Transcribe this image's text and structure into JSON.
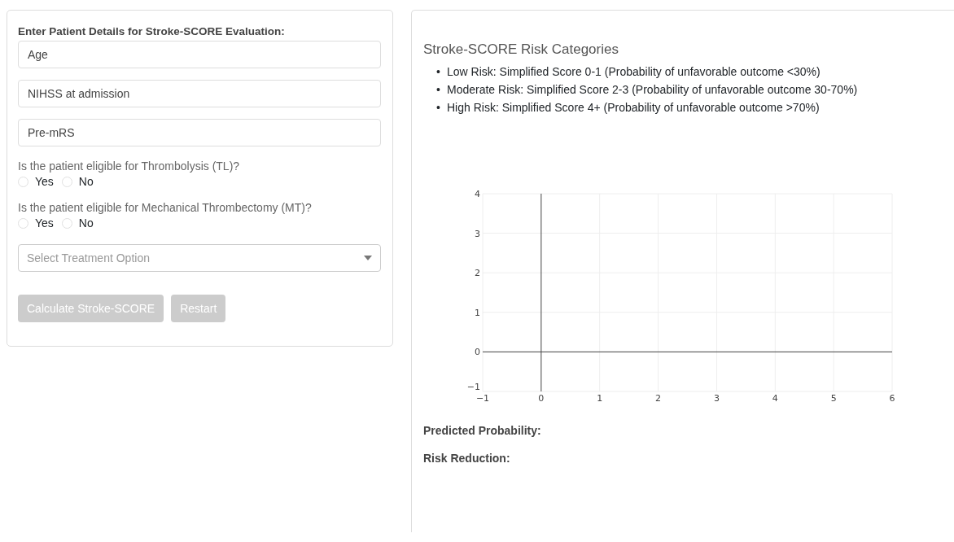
{
  "form": {
    "heading": "Enter Patient Details for Stroke-SCORE Evaluation:",
    "fields": [
      {
        "placeholder": "Age"
      },
      {
        "placeholder": "NIHSS at admission"
      },
      {
        "placeholder": "Pre-mRS"
      }
    ],
    "questions": [
      {
        "label": "Is the patient eligible for Thrombolysis (TL)?",
        "options": [
          {
            "label": "Yes",
            "selected": false
          },
          {
            "label": "No",
            "selected": false
          }
        ]
      },
      {
        "label": "Is the patient eligible for Mechanical Thrombectomy (MT)?",
        "options": [
          {
            "label": "Yes",
            "selected": false
          },
          {
            "label": "No",
            "selected": false
          }
        ]
      }
    ],
    "select": {
      "placeholder": "Select Treatment Option"
    },
    "buttons": [
      {
        "label": "Calculate Stroke-SCORE",
        "disabled": true
      },
      {
        "label": "Restart",
        "disabled": true
      }
    ]
  },
  "results": {
    "title": "Stroke-SCORE Risk Categories",
    "categories": [
      {
        "marker": "•",
        "text": "Low Risk: Simplified Score 0-1 (Probability of unfavorable outcome <30%)"
      },
      {
        "marker": "•",
        "text": "Moderate Risk: Simplified Score 2-3 (Probability of unfavorable outcome 30-70%)"
      },
      {
        "marker": "•",
        "text": "High Risk: Simplified Score 4+ (Probability of unfavorable outcome >70%)"
      }
    ],
    "chart_data": {
      "type": "scatter",
      "grid": true,
      "xlim": [
        -1,
        6
      ],
      "ylim": [
        -1,
        4
      ],
      "xticks": [
        {
          "value": -1,
          "label": "−1"
        },
        0,
        1,
        2,
        3,
        4,
        5,
        6
      ],
      "yticks": [
        {
          "value": -1,
          "label": "−1"
        },
        0,
        1,
        2,
        3,
        4
      ]
    },
    "outputs": [
      "Predicted Probability:",
      "Risk Reduction:"
    ]
  }
}
